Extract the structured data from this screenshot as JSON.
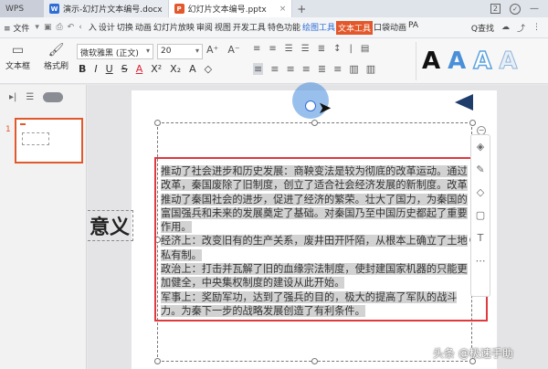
{
  "titlebar": {
    "wps_label": "WPS",
    "tabs": [
      {
        "label": "演示-幻灯片文本编号.docx",
        "icon": "W"
      },
      {
        "label": "幻灯片文本编号.pptx",
        "icon": "P"
      }
    ],
    "close_glyph": "×",
    "plus_glyph": "+",
    "badge_num": "2"
  },
  "menubar": {
    "file_label": "≡ 文件",
    "items": [
      "入",
      "设计",
      "切换",
      "动画",
      "幻灯片放映",
      "审阅",
      "视图",
      "开发工具",
      "特色功能",
      "绘图工具",
      "文本工具",
      "口袋动画",
      "PA"
    ],
    "search_label": "Q查找"
  },
  "ribbon": {
    "textbox_label": "文本框",
    "format_painter_label": "格式刷",
    "font_name": "微软雅黑 (正文)",
    "font_size": "20",
    "style_letter": "A",
    "fmt_row1": [
      "A⁺",
      "A⁻",
      "◇",
      "|"
    ],
    "fmt_row2": [
      "B",
      "I",
      "U",
      "S",
      "A",
      "X²",
      "X₂",
      "A",
      "◇"
    ],
    "para_row1": [
      "≡",
      "≡",
      "☰",
      "☰",
      "≣",
      "↕",
      "|",
      "▤"
    ],
    "para_row2": [
      "≡",
      "≡",
      "≡",
      "≡",
      "≣",
      "≡",
      "▥",
      "▥"
    ]
  },
  "leftpanel": {
    "slide_number": "1"
  },
  "slide": {
    "big_title": "意义",
    "paragraphs": [
      "推动了社会进步和历史发展：商鞅变法是较为彻底的改革运动。通过改革，秦国废除了旧制度，创立了适合社会经济发展的新制度。改革推动了秦国社会的进步，促进了经济的繁荣。壮大了国力，为秦国的富国强兵和未来的发展奠定了基础。对秦国乃至中国历史都起了重要作用。",
      "经济上：改变旧有的生产关系，废井田开阡陌，从根本上确立了土地私有制。",
      "政治上：打击并瓦解了旧的血缘宗法制度，使封建国家机器的只能更加健全，中央集权制度的建设从此开始。",
      "军事上：奖励军功，达到了强兵的目的，极大的提高了军队的战斗力。为秦下一步的战略发展创造了有利条件。"
    ]
  },
  "float_toolbar": {
    "icons": [
      "layers-icon",
      "pen-icon",
      "fill-icon",
      "border-icon",
      "text-style-icon",
      "more-icon"
    ]
  },
  "watermark": "头条 @极速手助"
}
